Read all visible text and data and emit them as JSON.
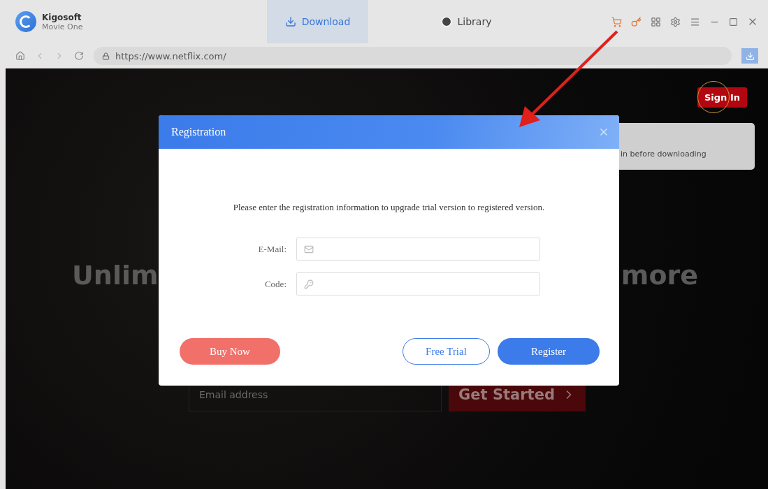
{
  "app": {
    "name": "Kigosoft",
    "subtitle": "Movie One"
  },
  "tabs": [
    {
      "label": "Download",
      "kind": "download",
      "selected": true
    },
    {
      "label": "Library",
      "kind": "clock",
      "selected": false
    }
  ],
  "address_bar": {
    "url": "https://www.netflix.com/"
  },
  "page": {
    "sign_in": "Sign In",
    "tooltip": "in before downloading",
    "headline_left": "Unlim",
    "headline_right": "more",
    "email_placeholder": "Email address",
    "cta": "Get Started"
  },
  "dialog": {
    "title": "Registration",
    "message": "Please enter the registration information to upgrade trial version to registered version.",
    "fields": [
      {
        "label": "E-Mail:",
        "kind": "email"
      },
      {
        "label": "Code:",
        "kind": "code"
      }
    ],
    "buttons": [
      {
        "label": "Buy Now",
        "kind": "danger"
      },
      {
        "label": "Free Trial",
        "kind": "outline"
      },
      {
        "label": "Register",
        "kind": "primary"
      }
    ]
  }
}
